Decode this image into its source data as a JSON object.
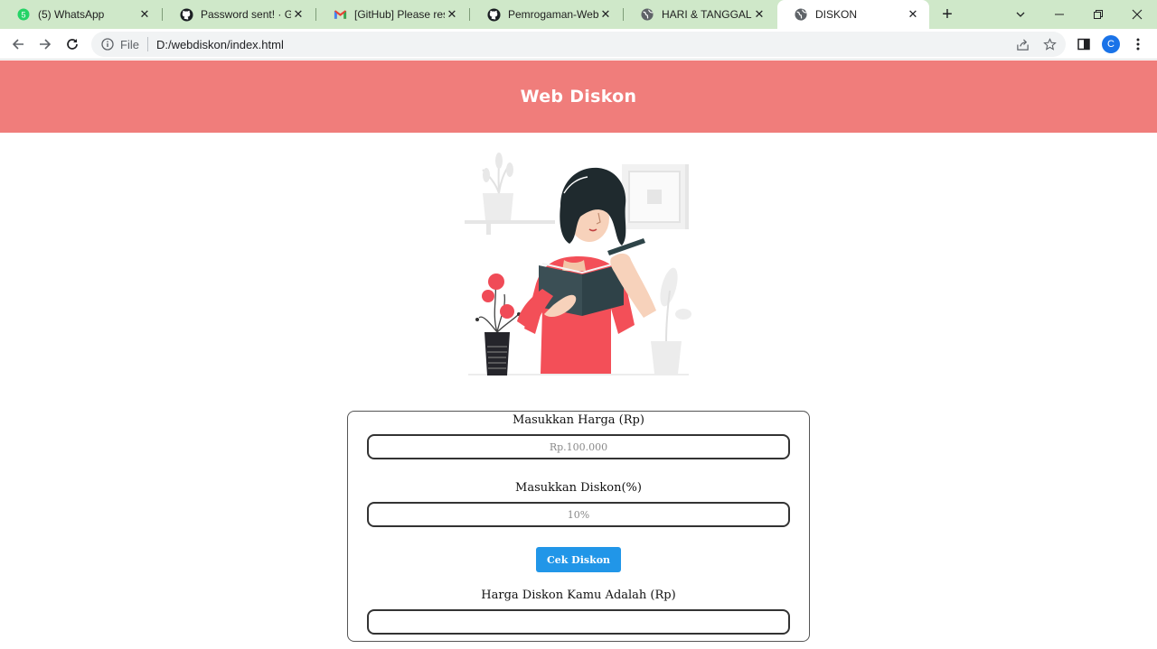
{
  "browser": {
    "tabs": [
      {
        "title": "(5) WhatsApp",
        "icon": "whatsapp-icon",
        "active": false
      },
      {
        "title": "Password sent! · GitHub",
        "icon": "github-icon",
        "active": false
      },
      {
        "title": "[GitHub] Please reset your password",
        "icon": "gmail-icon",
        "active": false
      },
      {
        "title": "Pemrogaman-Web/kode",
        "icon": "github-icon",
        "active": false
      },
      {
        "title": "HARI & TANGGAL",
        "icon": "globe-icon",
        "active": false
      },
      {
        "title": "DISKON",
        "icon": "globe-icon",
        "active": true
      }
    ],
    "address": {
      "scheme_label": "File",
      "url": "D:/webdiskon/index.html"
    },
    "profile_initial": "C",
    "accent_color": "#1a73e8"
  },
  "page": {
    "header_title": "Web Diskon",
    "header_color": "#f07d7b",
    "form": {
      "price_label": "Masukkan Harga (Rp)",
      "price_placeholder": "Rp.100.000",
      "discount_label": "Masukkan Diskon(%)",
      "discount_placeholder": "10%",
      "button_label": "Cek Diskon",
      "button_color": "#2196e8",
      "result_label": "Harga Diskon Kamu Adalah (Rp)",
      "result_value": ""
    }
  }
}
